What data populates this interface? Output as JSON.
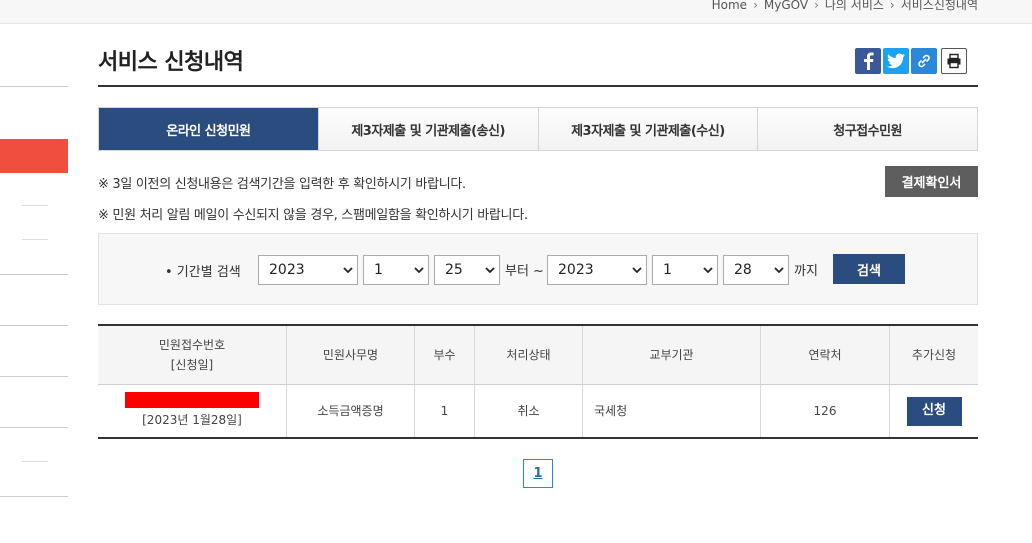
{
  "breadcrumb": [
    "Home",
    "MyGOV",
    "나의 서비스",
    "서비스신청내역"
  ],
  "page": {
    "title": "서비스 신청내역"
  },
  "share": [
    "facebook-icon",
    "twitter-icon",
    "link-icon",
    "print-icon"
  ],
  "tabs": [
    {
      "label": "온라인 신청민원",
      "active": true
    },
    {
      "label": "제3자제출 및 기관제출(송신)",
      "active": false
    },
    {
      "label": "제3자제출 및 기관제출(수신)",
      "active": false
    },
    {
      "label": "청구접수민원",
      "active": false
    }
  ],
  "notices": [
    "※ 3일 이전의 신청내용은 검색기간을 입력한 후 확인하시기 바랍니다.",
    "※ 민원 처리 알림 메일이 수신되지 않을 경우, 스팸메일함을 확인하시기 바랍니다."
  ],
  "confirm_button": "결제확인서",
  "search": {
    "label": "• 기간별 검색",
    "from": {
      "year": "2023",
      "month": "1",
      "day": "25"
    },
    "from_suffix": "부터 ~",
    "to": {
      "year": "2023",
      "month": "1",
      "day": "28"
    },
    "to_suffix": "까지",
    "button": "검색"
  },
  "table": {
    "headers": [
      "민원접수번호",
      "[신청일]",
      "민원사무명",
      "부수",
      "처리상태",
      "교부기관",
      "연락처",
      "추가신청"
    ],
    "rows": [
      {
        "date": "[2023년 1월28일]",
        "name": "소득금액증명",
        "copies": "1",
        "status": "취소",
        "agency": "국세청",
        "contact": "126",
        "action": "신청"
      }
    ]
  },
  "pagination": {
    "current": "1"
  },
  "colors": {
    "primary": "#2b4c7e",
    "sidebar_accent": "#f04e3e",
    "redaction": "#ff0000"
  }
}
